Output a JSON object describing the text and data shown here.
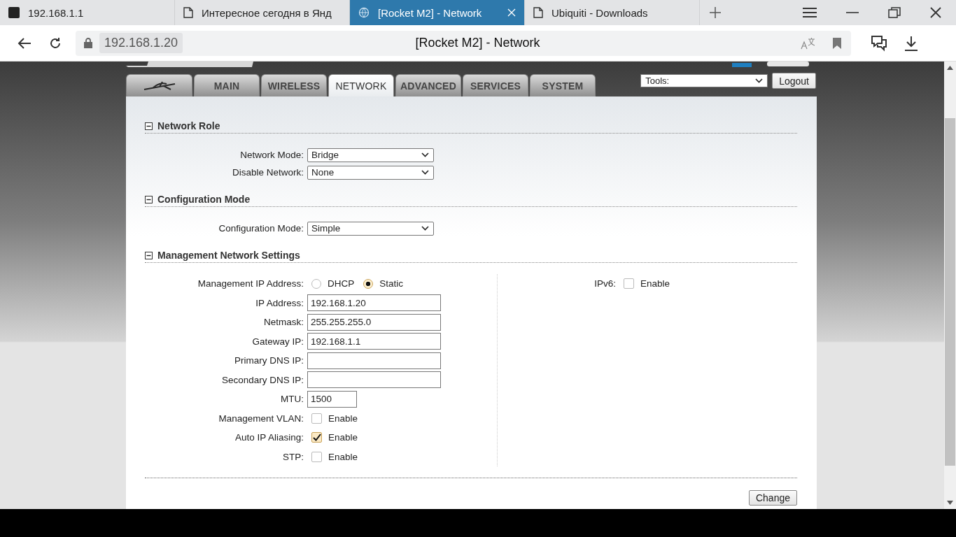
{
  "browser": {
    "tabs": [
      {
        "title": "192.168.1.1",
        "kind": "site",
        "selected": false
      },
      {
        "title": "Интересное сегодня в Янд",
        "kind": "page",
        "selected": false
      },
      {
        "title": "[Rocket M2] - Network",
        "kind": "router",
        "selected": true
      },
      {
        "title": "Ubiquiti - Downloads",
        "kind": "page",
        "selected": false
      }
    ],
    "address": "192.168.1.20",
    "page_title": "[Rocket M2] - Network"
  },
  "nav": {
    "tabs": [
      {
        "kind": "logo",
        "selected": false
      },
      {
        "kind": "text",
        "label": "MAIN",
        "selected": false
      },
      {
        "kind": "text",
        "label": "WIRELESS",
        "selected": false
      },
      {
        "kind": "text",
        "label": "NETWORK",
        "selected": true
      },
      {
        "kind": "text",
        "label": "ADVANCED",
        "selected": false
      },
      {
        "kind": "text",
        "label": "SERVICES",
        "selected": false
      },
      {
        "kind": "text",
        "label": "SYSTEM",
        "selected": false
      }
    ],
    "tools": "Tools:",
    "logout": "Logout"
  },
  "sections": [
    {
      "title": "Network Role",
      "expanded": true,
      "left": [
        {
          "kind": "select",
          "label": "Network Mode:",
          "value": "Bridge"
        },
        {
          "kind": "select",
          "label": "Disable Network:",
          "value": "None"
        }
      ]
    },
    {
      "title": "Configuration Mode",
      "expanded": true,
      "left": [
        {
          "kind": "select",
          "label": "Configuration Mode:",
          "value": "Simple"
        }
      ]
    },
    {
      "title": "Management Network Settings",
      "expanded": true,
      "left": [
        {
          "kind": "radio",
          "label": "Management IP Address:",
          "options": [
            {
              "label": "DHCP",
              "selected": false
            },
            {
              "label": "Static",
              "selected": true
            }
          ]
        },
        {
          "kind": "text",
          "label": "IP Address:",
          "value": "192.168.1.20"
        },
        {
          "kind": "text",
          "label": "Netmask:",
          "value": "255.255.255.0"
        },
        {
          "kind": "text",
          "label": "Gateway IP:",
          "value": "192.168.1.1"
        },
        {
          "kind": "text",
          "label": "Primary DNS IP:"
        },
        {
          "kind": "text",
          "label": "Secondary DNS IP:"
        },
        {
          "kind": "short",
          "label": "MTU:",
          "value": "1500"
        },
        {
          "kind": "checkbox",
          "label": "Management VLAN:",
          "option": "Enable",
          "checked": false
        },
        {
          "kind": "checkbox",
          "label": "Auto IP Aliasing:",
          "option": "Enable",
          "checked": true
        },
        {
          "kind": "checkbox",
          "label": "STP:",
          "option": "Enable",
          "checked": false
        }
      ],
      "right": [
        {
          "kind": "checkbox",
          "label": "IPv6:",
          "option": "Enable",
          "checked": false
        }
      ]
    }
  ],
  "change": "Change"
}
